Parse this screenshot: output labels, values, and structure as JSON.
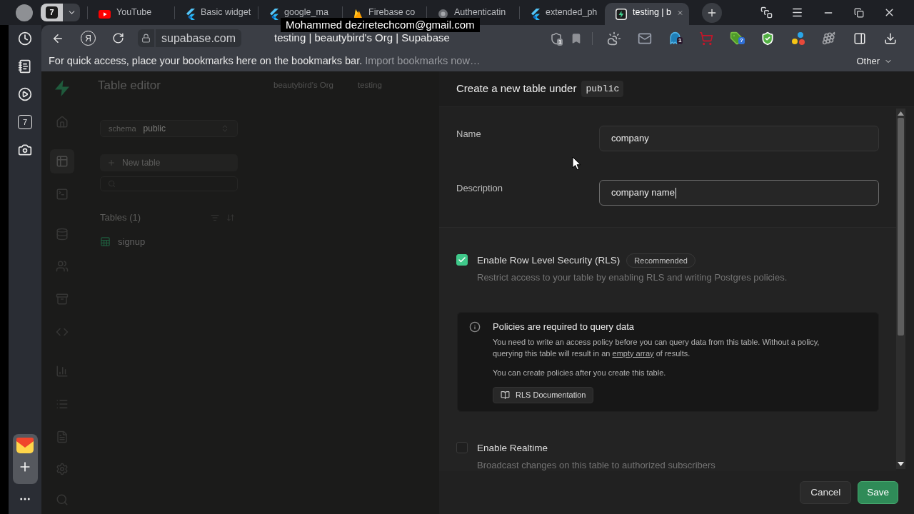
{
  "browser": {
    "tab_counter": "7",
    "tabs": [
      {
        "kind": "video",
        "label": "YouTube",
        "selected": false
      },
      {
        "kind": "flutter",
        "label": "Basic widget",
        "selected": false
      },
      {
        "kind": "flutter",
        "label": "google_ma",
        "selected": false
      },
      {
        "kind": "firebase",
        "label": "Firebase co",
        "selected": false
      },
      {
        "kind": "generic",
        "label": "Authenticatin",
        "selected": false
      },
      {
        "kind": "flutter",
        "label": "extended_ph",
        "selected": false
      },
      {
        "kind": "supabase",
        "label": "testing | b",
        "selected": true
      }
    ],
    "tooltip": "Mohammed deziretechcom@gmail.com",
    "browser_logo": "Я",
    "address_bar": {
      "url": "supabase.com",
      "page_title": "testing | beautybird's Org | Supabase"
    },
    "extension_badges": [
      "1",
      "1",
      "?"
    ],
    "bookmarks_bar": {
      "hint": "For quick access, place your bookmarks here on the bookmarks bar.",
      "import_link": "Import bookmarks now…",
      "other_folder": "Other"
    },
    "sidebar": {
      "calendar_day": "7"
    }
  },
  "page": {
    "title": "Table editor",
    "breadcrumbs": [
      "beautybird's Org",
      "testing"
    ],
    "nav": [
      {
        "kind": "home",
        "selected": false
      },
      {
        "kind": "table",
        "selected": true
      },
      {
        "kind": "sql",
        "selected": false
      },
      {
        "kind": "database",
        "selected": false
      },
      {
        "kind": "auth",
        "selected": false
      },
      {
        "kind": "storage",
        "selected": false
      },
      {
        "kind": "functions",
        "selected": false
      },
      {
        "kind": "reports",
        "selected": false
      },
      {
        "kind": "logs",
        "selected": false
      },
      {
        "kind": "docs",
        "selected": false
      },
      {
        "kind": "settings",
        "selected": false
      },
      {
        "kind": "search",
        "selected": false
      }
    ],
    "schema": {
      "label": "schema",
      "value": "public"
    },
    "new_table_button": "New table",
    "tables_heading": "Tables (1)",
    "tables": [
      {
        "name": "signup"
      }
    ]
  },
  "dialog": {
    "title": "Create a new table under",
    "schema": "public",
    "fields": [
      {
        "label": "Name",
        "value": "company",
        "focused": false
      },
      {
        "label": "Description",
        "value": "company name",
        "focused": true
      }
    ],
    "options": [
      {
        "label": "Enable Row Level Security (RLS)",
        "badge": "Recommended",
        "description": "Restrict access to your table by enabling RLS and writing Postgres policies.",
        "checked": true,
        "alert": {
          "title": "Policies are required to query data",
          "text_before": "You need to write an access policy before you can query data from this table. Without a policy, querying this table will result in an",
          "link": "empty array",
          "text_after": "of results.",
          "note": "You can create policies after you create this table.",
          "button": "RLS Documentation"
        }
      },
      {
        "label": "Enable Realtime",
        "description": "Broadcast changes on this table to authorized subscribers",
        "checked": false
      }
    ],
    "buttons": [
      {
        "kind": "secondary",
        "label": "Cancel"
      },
      {
        "kind": "primary",
        "label": "Save"
      }
    ]
  }
}
